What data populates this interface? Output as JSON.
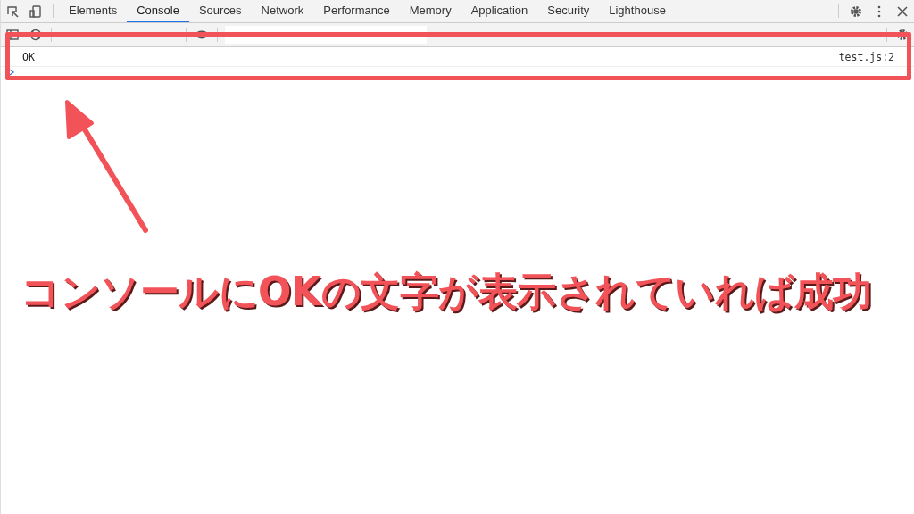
{
  "tabs": [
    {
      "label": "Elements",
      "selected": false
    },
    {
      "label": "Console",
      "selected": true
    },
    {
      "label": "Sources",
      "selected": false
    },
    {
      "label": "Network",
      "selected": false
    },
    {
      "label": "Performance",
      "selected": false
    },
    {
      "label": "Memory",
      "selected": false
    },
    {
      "label": "Application",
      "selected": false
    },
    {
      "label": "Security",
      "selected": false
    },
    {
      "label": "Lighthouse",
      "selected": false
    }
  ],
  "messages": [
    {
      "text": "OK",
      "source": "test.js:2"
    }
  ],
  "annotation": {
    "caption": "コンソールにOKの文字が表示されていれば成功"
  }
}
